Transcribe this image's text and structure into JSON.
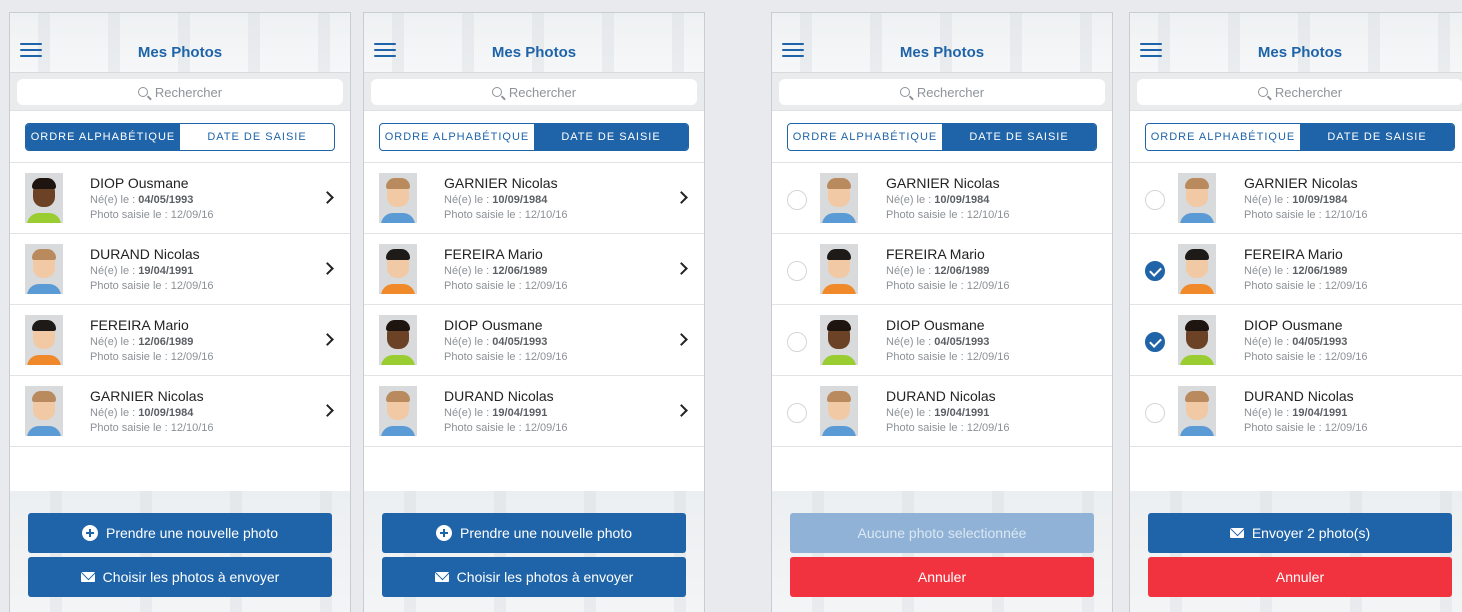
{
  "colors": {
    "brand": "#1f64a8",
    "danger": "#f0333e",
    "disabled": "#8fb2d6"
  },
  "common": {
    "title": "Mes Photos",
    "search_placeholder": "Rechercher",
    "seg_alpha": "ORDRE ALPHABÉTIQUE",
    "seg_date": "DATE DE SAISIE",
    "birth_prefix": "Né(e) le : ",
    "saisie_prefix": "Photo saisie le : ",
    "btn_new_photo": "Prendre une nouvelle photo",
    "btn_choose": "Choisir les photos à envoyer",
    "btn_none_selected": "Aucune photo selectionnée",
    "btn_send": "Envoyer 2 photo(s)",
    "btn_cancel": "Annuler"
  },
  "screens": [
    {
      "active_segment": "alpha",
      "mode": "browse",
      "rows": [
        {
          "name": "DIOP Ousmane",
          "birth": "04/05/1993",
          "saisie": "12/09/16",
          "skin": "dark",
          "selected": false
        },
        {
          "name": "DURAND Nicolas",
          "birth": "19/04/1991",
          "saisie": "12/09/16",
          "skin": "light",
          "selected": false
        },
        {
          "name": "FEREIRA Mario",
          "birth": "12/06/1989",
          "saisie": "12/09/16",
          "skin": "light-darkhair",
          "selected": false
        },
        {
          "name": "GARNIER Nicolas",
          "birth": "10/09/1984",
          "saisie": "12/10/16",
          "skin": "light",
          "selected": false
        }
      ]
    },
    {
      "active_segment": "date",
      "mode": "browse",
      "rows": [
        {
          "name": "GARNIER Nicolas",
          "birth": "10/09/1984",
          "saisie": "12/10/16",
          "skin": "light",
          "selected": false
        },
        {
          "name": "FEREIRA Mario",
          "birth": "12/06/1989",
          "saisie": "12/09/16",
          "skin": "light-darkhair",
          "selected": false
        },
        {
          "name": "DIOP Ousmane",
          "birth": "04/05/1993",
          "saisie": "12/09/16",
          "skin": "dark",
          "selected": false
        },
        {
          "name": "DURAND Nicolas",
          "birth": "19/04/1991",
          "saisie": "12/09/16",
          "skin": "light",
          "selected": false
        }
      ]
    },
    {
      "active_segment": "date",
      "mode": "select-none",
      "rows": [
        {
          "name": "GARNIER Nicolas",
          "birth": "10/09/1984",
          "saisie": "12/10/16",
          "skin": "light",
          "selected": false
        },
        {
          "name": "FEREIRA Mario",
          "birth": "12/06/1989",
          "saisie": "12/09/16",
          "skin": "light-darkhair",
          "selected": false
        },
        {
          "name": "DIOP Ousmane",
          "birth": "04/05/1993",
          "saisie": "12/09/16",
          "skin": "dark",
          "selected": false
        },
        {
          "name": "DURAND Nicolas",
          "birth": "19/04/1991",
          "saisie": "12/09/16",
          "skin": "light",
          "selected": false
        }
      ]
    },
    {
      "active_segment": "date",
      "mode": "select-some",
      "rows": [
        {
          "name": "GARNIER Nicolas",
          "birth": "10/09/1984",
          "saisie": "12/10/16",
          "skin": "light",
          "selected": false
        },
        {
          "name": "FEREIRA Mario",
          "birth": "12/06/1989",
          "saisie": "12/09/16",
          "skin": "light-darkhair",
          "selected": true
        },
        {
          "name": "DIOP Ousmane",
          "birth": "04/05/1993",
          "saisie": "12/09/16",
          "skin": "dark",
          "selected": true
        },
        {
          "name": "DURAND Nicolas",
          "birth": "19/04/1991",
          "saisie": "12/09/16",
          "skin": "light",
          "selected": false
        }
      ]
    }
  ]
}
